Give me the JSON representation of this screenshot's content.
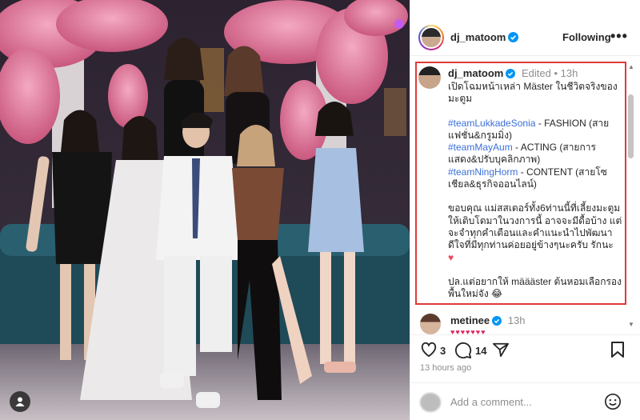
{
  "post": {
    "username": "dj_matoom",
    "follow_label": "Following",
    "more_label": "•••"
  },
  "caption": {
    "username": "dj_matoom",
    "meta": "Edited • 13h",
    "lines": [
      "เปิดโฉมหน้าเหล่า Mäster ในชีวิตจริงของ",
      "มะตูม"
    ],
    "teams": [
      {
        "tag": "#teamLukkadeSonia",
        "rest": " - FASHION (สาย",
        "line2": "แฟชั่น&กรูมมิ่ง)"
      },
      {
        "tag": "#teamMayAum",
        "rest": " - ACTING (สายการ",
        "line2": "แสดง&ปรับบุคลิกภาพ)"
      },
      {
        "tag": "#teamNingHorm",
        "rest": " - CONTENT (สายโซ",
        "line2": "เชียล&ธุรกิจออนไลน์)"
      }
    ],
    "thanks": [
      "ขอบคุณ แม่สสเตอร์ทั้ง6ท่านนี้ที่เลี้ยงมะตูม",
      "ให้เติบโตมาในวงการนี้ อาจจะมีดื้อบ้าง แต่",
      "จะจำทุกคำเตือนและคำแนะนำไปพัฒนา",
      "ดีใจที่มีทุกท่านค่อยอยู่ข้างๆนะครับ รักนะ"
    ],
    "heart": "♥",
    "ps": [
      "ปล.แต่อยากให้ määäster ต้นหอมเลือกรอง",
      "พื้นใหม่จัง 😂"
    ]
  },
  "comment": {
    "username": "metinee",
    "time": "13h",
    "hearts": "♥♥♥♥♥♥♥"
  },
  "actions": {
    "likes": "3",
    "comments": "14",
    "time_ago": "13 hours ago"
  },
  "add_comment": {
    "placeholder": "Add a comment..."
  },
  "colors": {
    "verified": "#0095f6",
    "highlight_box": "#e03a3a",
    "hashtag": "#3a6fd8"
  }
}
